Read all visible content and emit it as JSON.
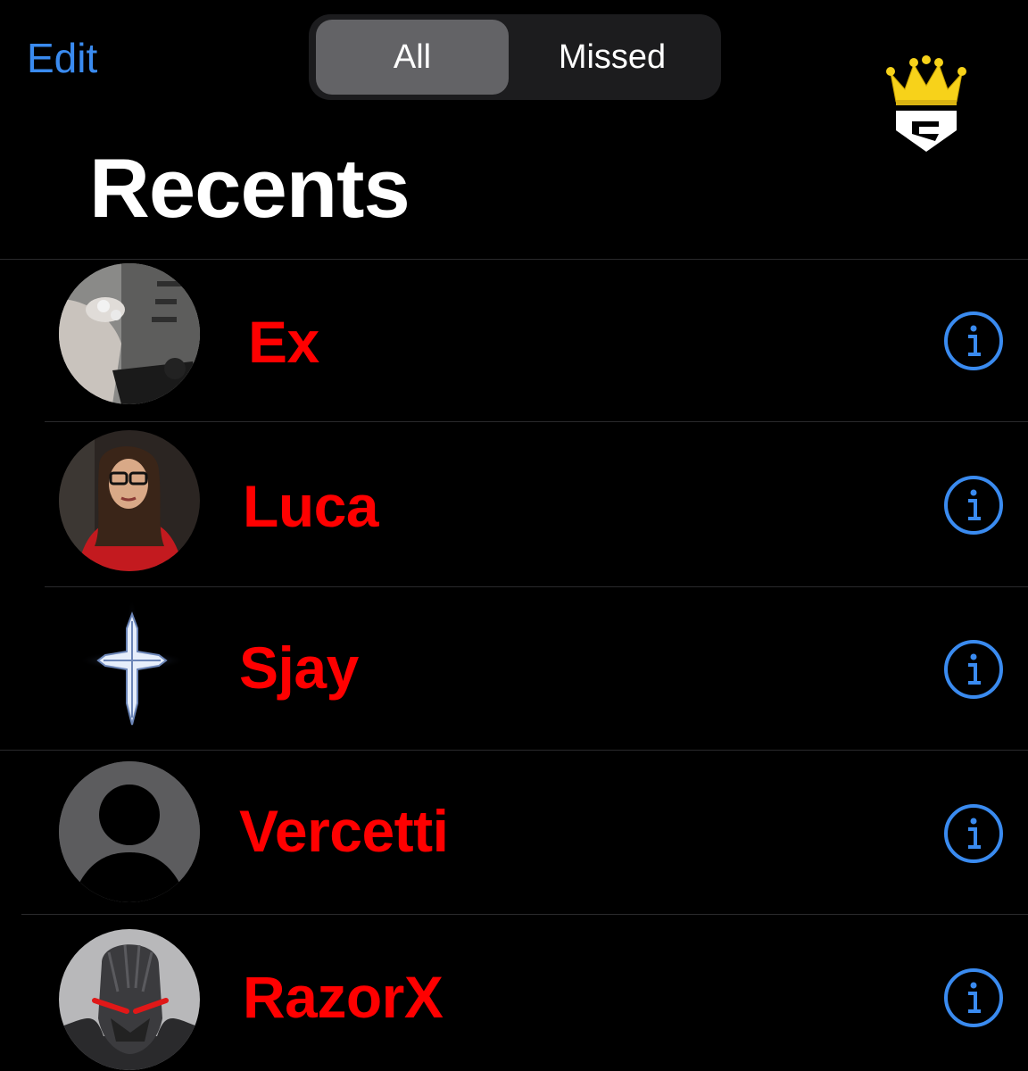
{
  "header": {
    "edit_label": "Edit",
    "segments": [
      "All",
      "Missed"
    ],
    "selected_segment": "All",
    "title": "Recents"
  },
  "colors": {
    "accent_blue": "#3a8bf0",
    "name_red": "#ff0000",
    "background": "#000000"
  },
  "recents": [
    {
      "name": "Ex",
      "avatar": "photo-hand-rings"
    },
    {
      "name": "Luca",
      "avatar": "photo-person-glasses"
    },
    {
      "name": "Sjay",
      "avatar": "cross-icon"
    },
    {
      "name": "Vercetti",
      "avatar": "default-person-icon"
    },
    {
      "name": "RazorX",
      "avatar": "photo-robot-helmet"
    }
  ],
  "info_icon": "info-circle-icon"
}
